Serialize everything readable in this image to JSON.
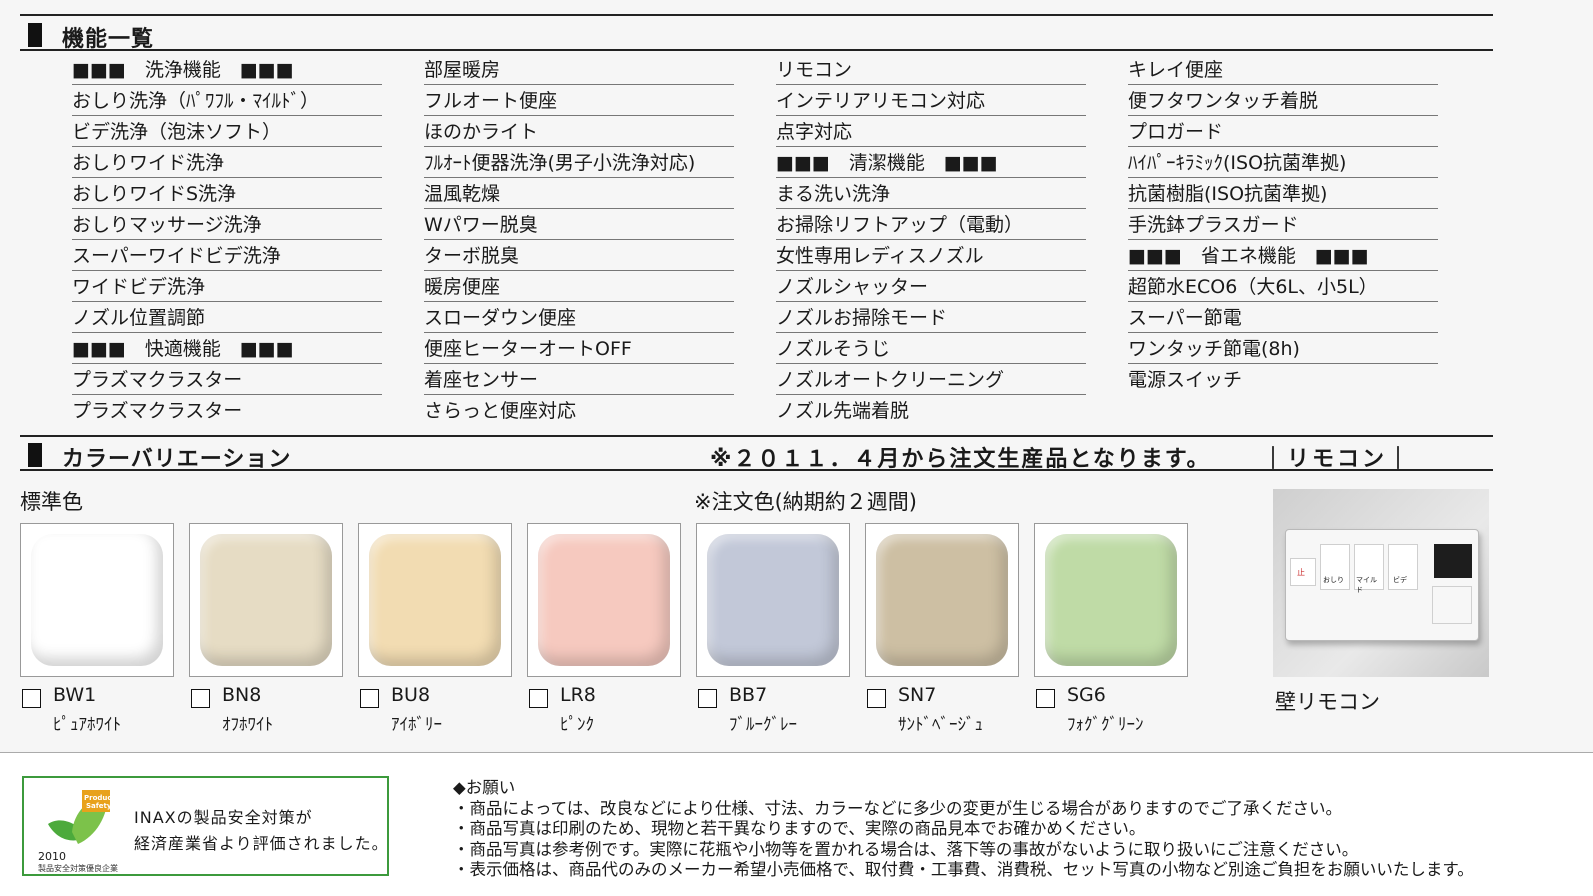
{
  "features": {
    "title": "機能一覧",
    "columns": [
      [
        "■■■　洗浄機能　■■■",
        "おしり洗浄（ﾊﾟﾜﾌﾙ・ﾏｲﾙﾄﾞ）",
        "ビデ洗浄（泡沫ソフト）",
        "おしりワイド洗浄",
        "おしりワイドS洗浄",
        "おしりマッサージ洗浄",
        "スーパーワイドビデ洗浄",
        "ワイドビデ洗浄",
        "ノズル位置調節",
        "■■■　快適機能　■■■",
        "プラズマクラスター",
        "プラズマクラスター"
      ],
      [
        "部屋暖房",
        "フルオート便座",
        "ほのかライト",
        "ﾌﾙｵｰﾄ便器洗浄(男子小洗浄対応)",
        "温風乾燥",
        "Wパワー脱臭",
        "ターボ脱臭",
        "暖房便座",
        "スローダウン便座",
        "便座ヒーターオートOFF",
        "着座センサー",
        "さらっと便座対応"
      ],
      [
        "リモコン",
        "インテリアリモコン対応",
        "点字対応",
        "■■■　清潔機能　■■■",
        "まる洗い洗浄",
        "お掃除リフトアップ（電動）",
        "女性専用レディスノズル",
        "ノズルシャッター",
        "ノズルお掃除モード",
        "ノズルそうじ",
        "ノズルオートクリーニング",
        "ノズル先端着脱"
      ],
      [
        "キレイ便座",
        "便フタワンタッチ着脱",
        "プロガード",
        "ﾊｲﾊﾟｰｷﾗﾐｯｸ(ISO抗菌準拠)",
        "抗菌樹脂(ISO抗菌準拠)",
        "手洗鉢プラスガード",
        "■■■　省エネ機能　■■■",
        "超節水ECO6（大6L、小5L）",
        "スーパー節電",
        "ワンタッチ節電(8h)",
        "電源スイッチ"
      ]
    ]
  },
  "colors": {
    "title": "カラーバリエーション",
    "notice": "※２０１１．４月から注文生産品となります。",
    "remocon_tag": "｜リモコン｜",
    "standard_label": "標準色",
    "order_label": "※注文色(納期約２週間)",
    "items": [
      {
        "code": "BW1",
        "name": "ﾋﾟｭｱﾎﾜｲﾄ",
        "color": "#ffffff"
      },
      {
        "code": "BN8",
        "name": "ｵﾌﾎﾜｲﾄ",
        "color": "#e6dcc4"
      },
      {
        "code": "BU8",
        "name": "ｱｲﾎﾞﾘｰ",
        "color": "#f2dcb2"
      },
      {
        "code": "LR8",
        "name": "ﾋﾟﾝｸ",
        "color": "#f6c9bf"
      },
      {
        "code": "BB7",
        "name": "ﾌﾞﾙｰｸﾞﾚｰ",
        "color": "#c2c8d8"
      },
      {
        "code": "SN7",
        "name": "ｻﾝﾄﾞﾍﾞｰｼﾞｭ",
        "color": "#cdbfa3"
      },
      {
        "code": "SG6",
        "name": "ﾌｫｸﾞｸﾞﾘｰﾝ",
        "color": "#bfdba6"
      }
    ],
    "remote_caption": "壁リモコン",
    "remote_labels": [
      "おしり",
      "マイルド",
      "ビデ",
      "止"
    ]
  },
  "footer": {
    "badge": {
      "logo_text": "Product Safety",
      "year": "2010",
      "award": "製品安全対策優良企業",
      "line1": "INAXの製品安全対策が",
      "line2": "経済産業省より評価されました。",
      "accent": "#3c9a3c"
    },
    "notes_title": "◆お願い",
    "notes": [
      "・商品によっては、改良などにより仕様、寸法、カラーなどに多少の変更が生じる場合がありますのでご了承ください。",
      "・商品写真は印刷のため、現物と若干異なりますので、実際の商品見本でお確かめください。",
      "・商品写真は参考例です。実際に花瓶や小物等を置かれる場合は、落下等の事故がないように取り扱いにご注意ください。",
      "・表示価格は、商品代のみのメーカー希望小売価格で、取付費・工事費、消費税、セット写真の小物など別途ご負担をお願いいたします。"
    ]
  }
}
